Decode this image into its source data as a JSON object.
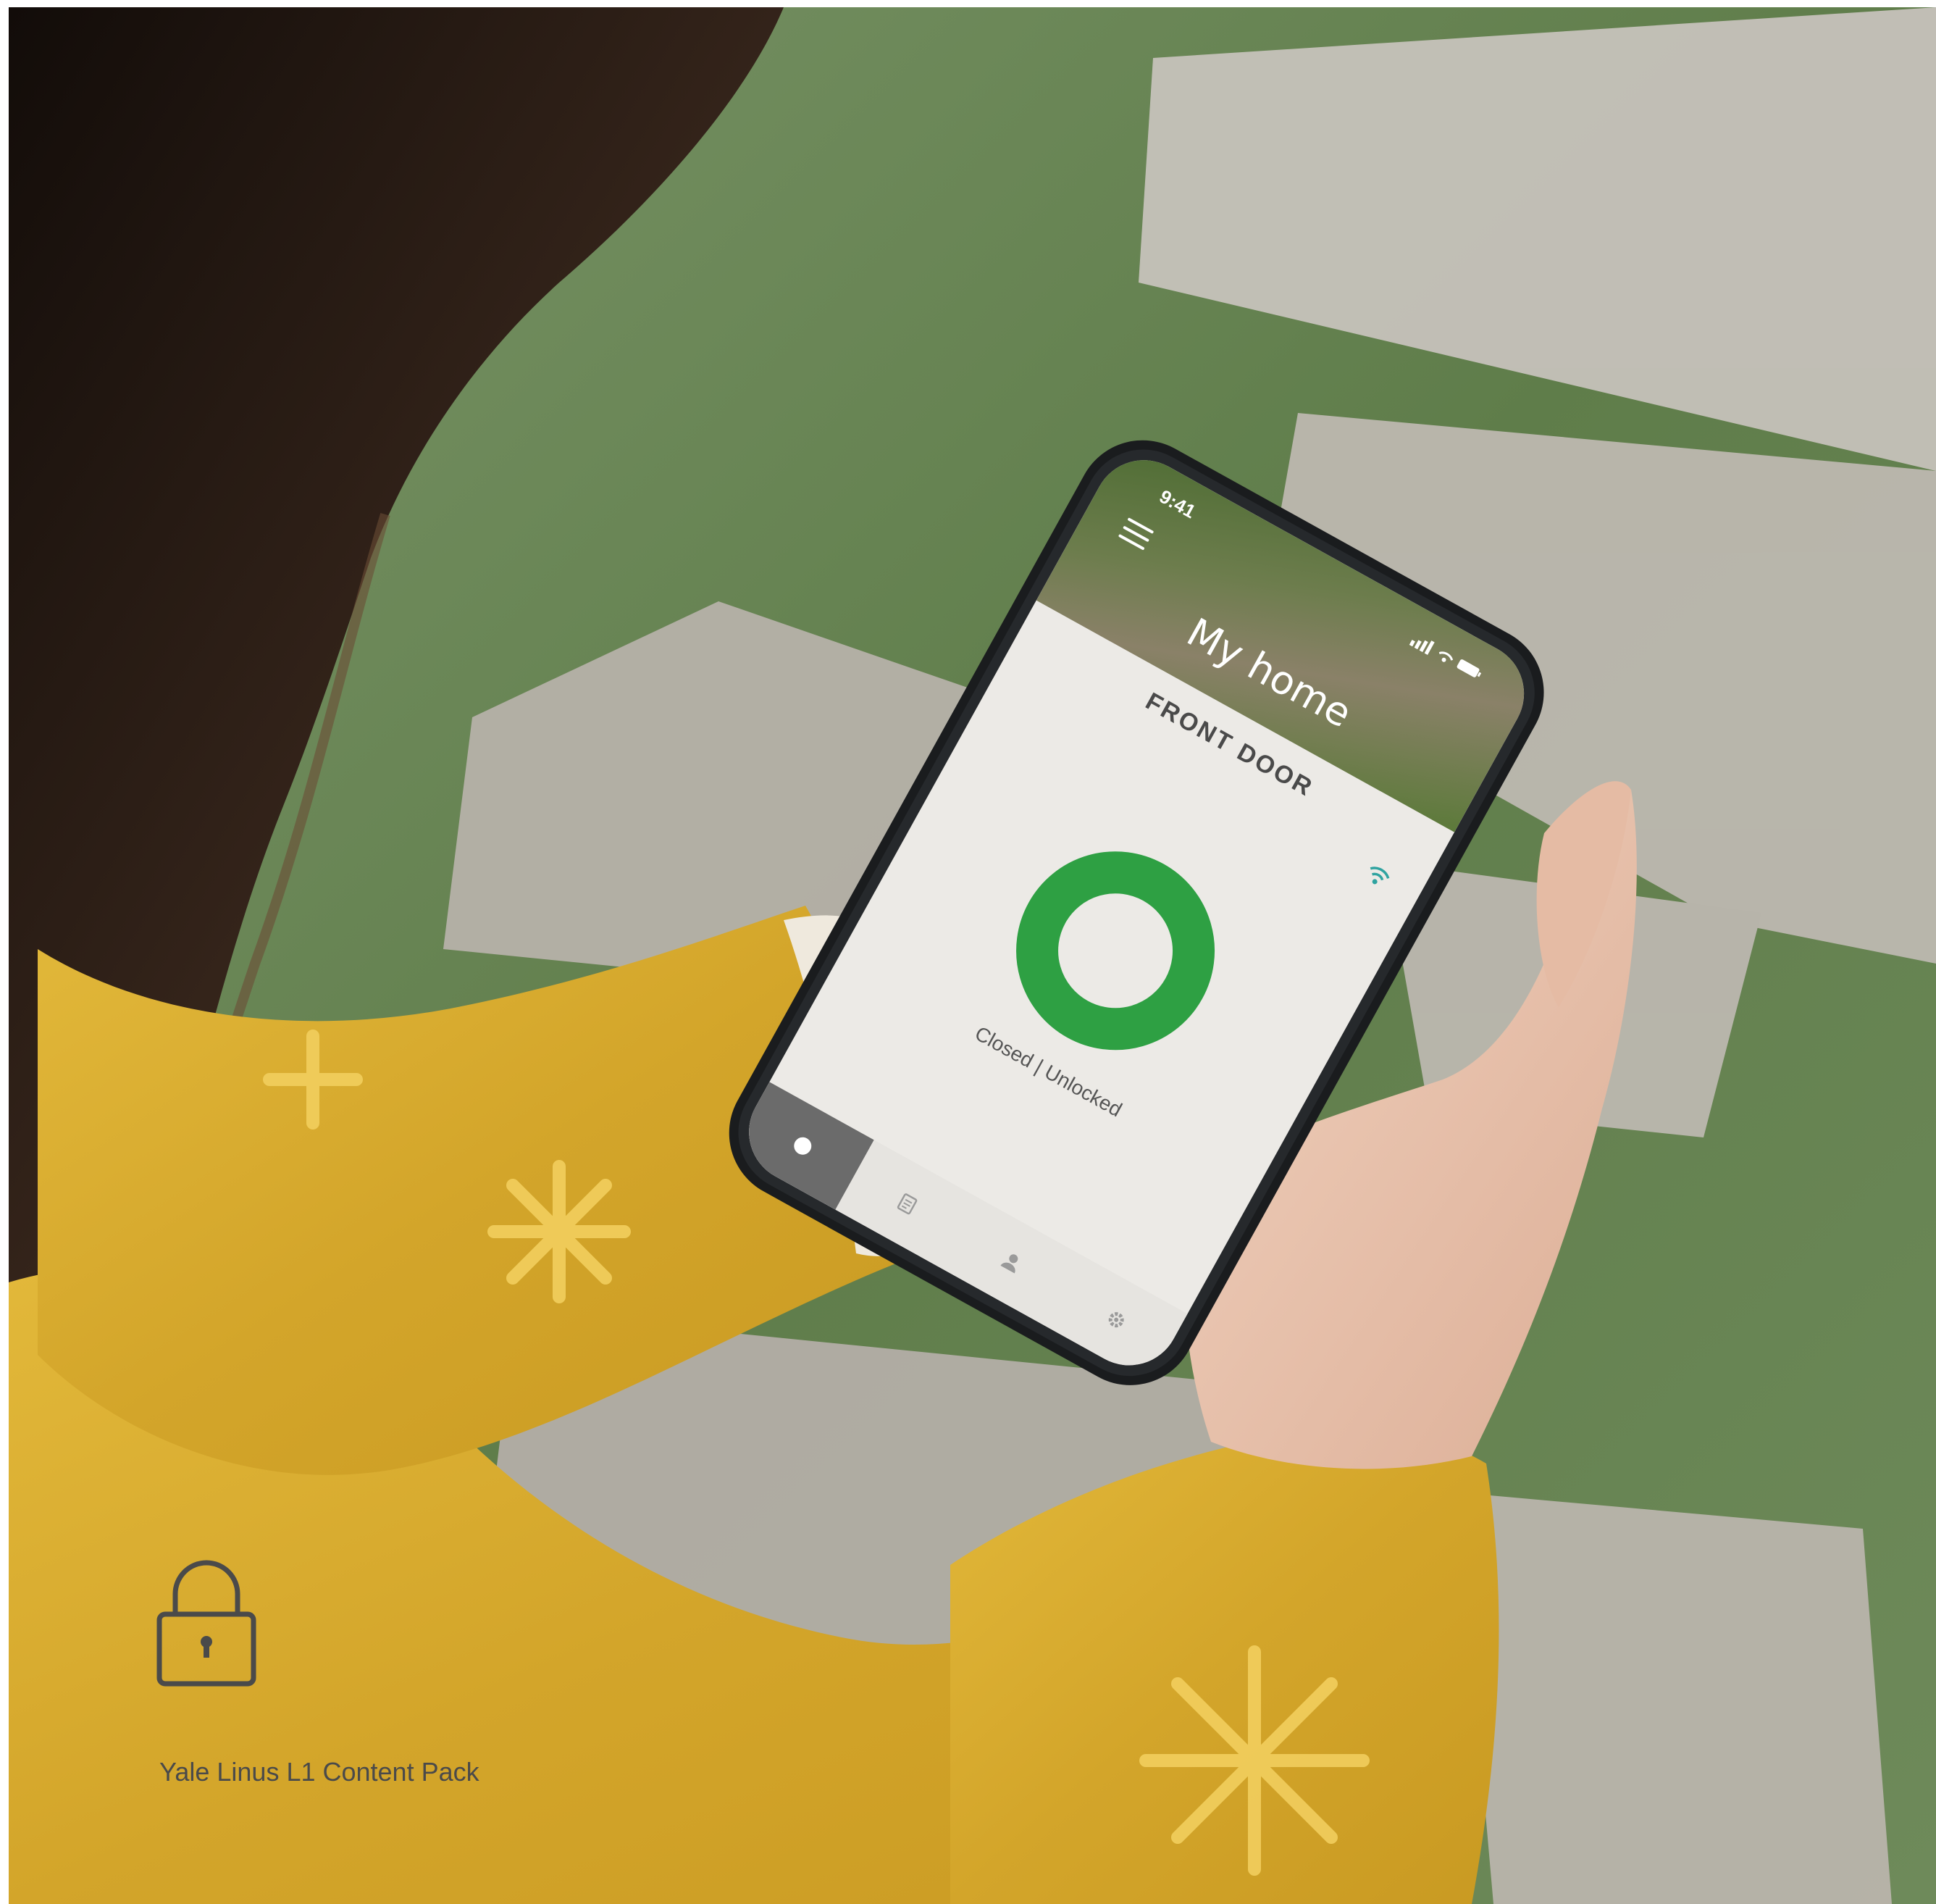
{
  "caption": {
    "text": "Yale Linus L1 Content Pack",
    "icon": "padlock-icon"
  },
  "phone": {
    "status_time": "9:41",
    "status_icons": "signal-wifi-battery-icons",
    "home_title": "My home",
    "door_title": "FRONT DOOR",
    "lock_status": "Closed | Unlocked",
    "tabs": [
      "lock-tab-icon",
      "activity-tab-icon",
      "users-tab-icon",
      "settings-tab-icon"
    ]
  },
  "colors": {
    "lock_ring": "#2ea043",
    "sweater": "#d9ad2e",
    "grass": "#6e8a5a",
    "paving": "#b8b3ab",
    "hair": "#2b1e17",
    "phone_frame": "#1a1c1e",
    "screen_bg": "#eceae6",
    "wifi": "#2fa3a0"
  }
}
